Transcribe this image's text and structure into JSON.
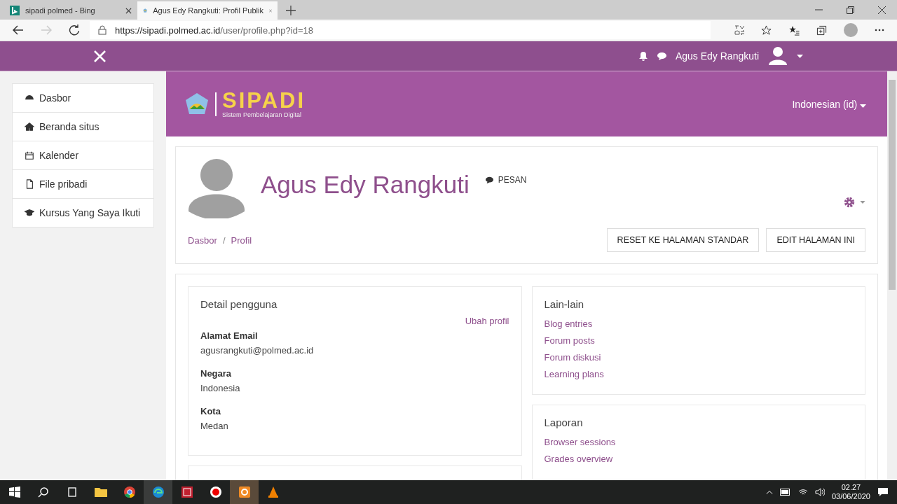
{
  "browser": {
    "tabs": [
      {
        "title": "sipadi polmed - Bing",
        "selected": false
      },
      {
        "title": "Agus Edy Rangkuti: Profil Publik",
        "selected": true
      }
    ],
    "url_host": "https://sipadi.polmed.ac.id",
    "url_path": "/user/profile.php?id=18"
  },
  "navbar": {
    "user": "Agus Edy Rangkuti"
  },
  "sidebar": {
    "items": [
      {
        "label": "Dasbor",
        "kind": "dashboard"
      },
      {
        "label": "Beranda situs",
        "kind": "home"
      },
      {
        "label": "Kalender",
        "kind": "calendar"
      },
      {
        "label": "File pribadi",
        "kind": "file"
      },
      {
        "label": "Kursus Yang Saya Ikuti",
        "kind": "course"
      }
    ]
  },
  "header": {
    "logo_title": "SIPADI",
    "logo_subtitle": "Sistem Pembelajaran Digital",
    "language": "Indonesian (id)"
  },
  "profile": {
    "name": "Agus Edy Rangkuti",
    "message": "PESAN",
    "breadcrumb": [
      "Dasbor",
      "Profil"
    ],
    "breadcrumb_separator": "/",
    "buttons": [
      "RESET KE HALAMAN STANDAR",
      "EDIT HALAMAN INI"
    ]
  },
  "details": {
    "title": "Detail pengguna",
    "edit_link": "Ubah profil",
    "email": {
      "label": "Alamat Email",
      "value": "agusrangkuti@polmed.ac.id"
    },
    "fields": [
      {
        "label": "Negara",
        "value": "Indonesia"
      },
      {
        "label": "Kota",
        "value": "Medan"
      }
    ]
  },
  "side_cards": [
    {
      "title": "Lain-lain",
      "links": [
        "Blog entries",
        "Forum posts",
        "Forum diskusi",
        "Learning plans"
      ]
    },
    {
      "title": "Laporan",
      "links": [
        "Browser sessions",
        "Grades overview"
      ]
    }
  ],
  "taskbar": {
    "time": "02.27",
    "date": "03/06/2020"
  }
}
